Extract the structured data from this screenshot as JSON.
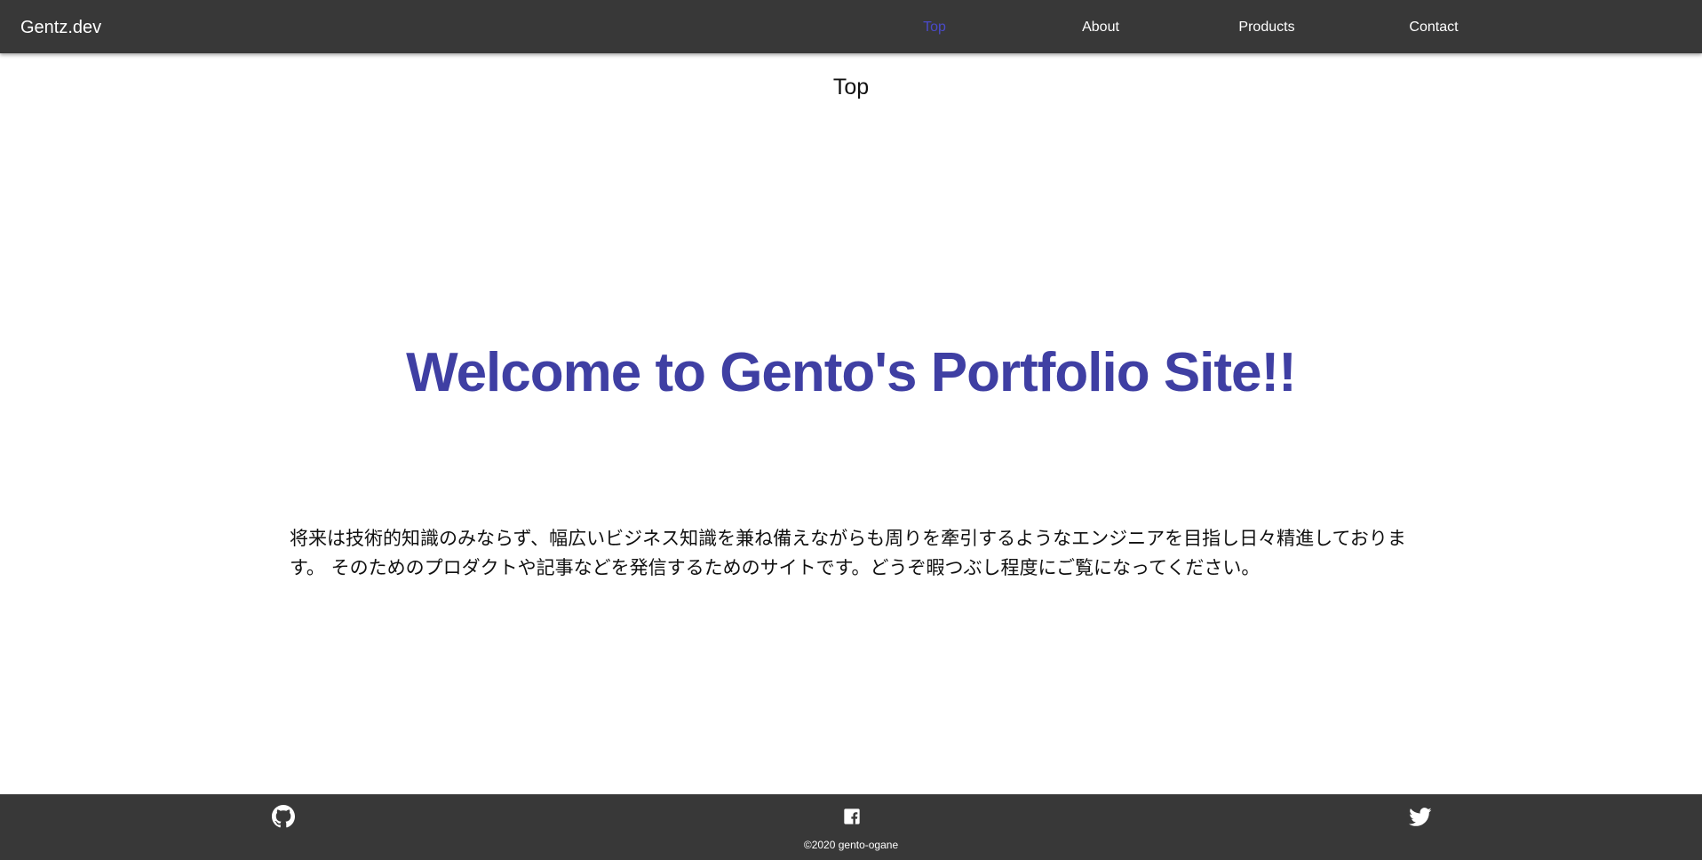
{
  "header": {
    "brand": "Gentz.dev",
    "nav": [
      {
        "label": "Top",
        "active": true
      },
      {
        "label": "About",
        "active": false
      },
      {
        "label": "Products",
        "active": false
      },
      {
        "label": "Contact",
        "active": false
      }
    ]
  },
  "main": {
    "section_title": "Top",
    "hero_title": "Welcome to Gento's Portfolio Site!!",
    "intro": "将来は技術的知識のみならず、幅広いビジネス知識を兼ね備えながらも周りを牽引するようなエンジニアを目指し日々精進しております。 そのためのプロダクトや記事などを発信するためのサイトです。どうぞ暇つぶし程度にご覧になってください。"
  },
  "footer": {
    "social": [
      {
        "icon": "github-icon"
      },
      {
        "icon": "facebook-icon"
      },
      {
        "icon": "twitter-icon"
      }
    ],
    "copyright": "©2020 gento-ogane"
  },
  "colors": {
    "header_bg": "#383838",
    "accent": "#3f3fa3",
    "active_nav": "#4a4ac8",
    "footer_bg": "#383838"
  }
}
